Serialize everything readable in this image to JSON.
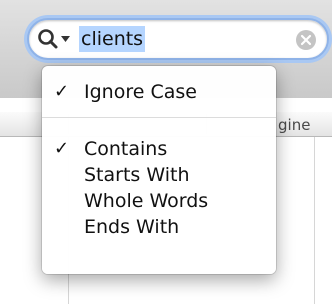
{
  "search": {
    "query": "clients"
  },
  "table": {
    "visible_column_fragment": "gine"
  },
  "menu": {
    "options": [
      {
        "label": "Ignore Case",
        "checked": true
      }
    ],
    "match_modes": [
      {
        "label": "Contains",
        "checked": true
      },
      {
        "label": "Starts With",
        "checked": false
      },
      {
        "label": "Whole Words",
        "checked": false
      },
      {
        "label": "Ends With",
        "checked": false
      }
    ],
    "check_glyph": "✓"
  },
  "colors": {
    "selection_highlight": "#b5d5ff",
    "focus_ring": "#a9c8f3"
  }
}
